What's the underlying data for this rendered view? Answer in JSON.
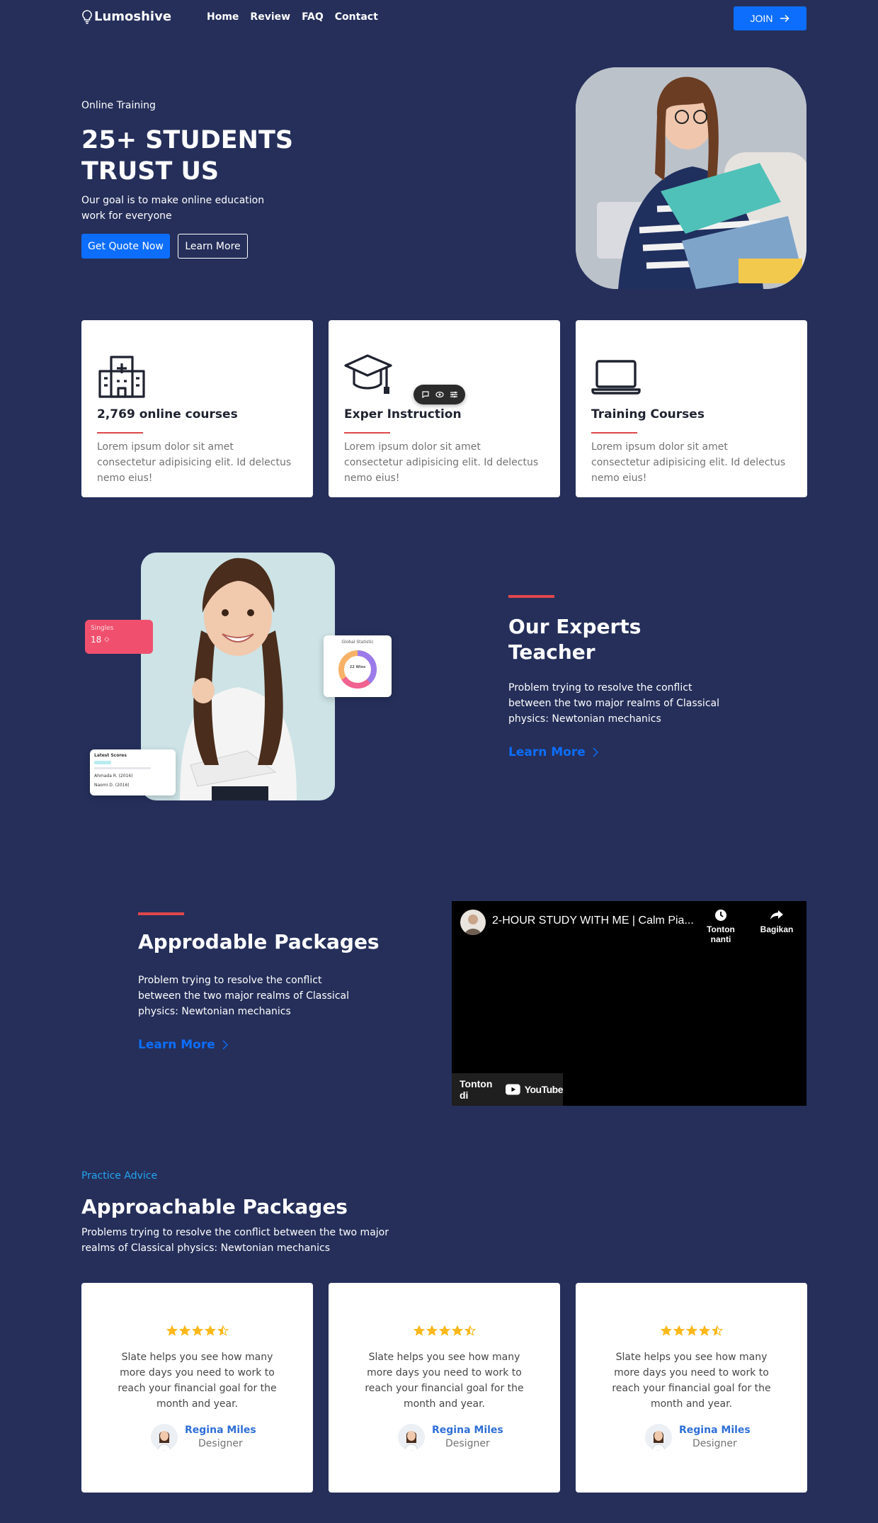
{
  "nav": {
    "logo": "Lumoshive",
    "links": [
      "Home",
      "Review",
      "FAQ",
      "Contact"
    ],
    "join_label": "JOIN"
  },
  "hero": {
    "eyebrow": "Online Training",
    "title": "25+ STUDENTS TRUST US",
    "description": "Our goal is to make online education work for everyone",
    "primary_button": "Get Quote Now",
    "secondary_button": "Learn More"
  },
  "features": [
    {
      "icon": "hospital-building-icon",
      "title": "2,769 online courses",
      "text": "Lorem ipsum dolor sit amet consectetur adipisicing elit. Id delectus nemo eius!"
    },
    {
      "icon": "graduation-cap-icon",
      "title": "Exper Instruction",
      "text": "Lorem ipsum dolor sit amet consectetur adipisicing elit. Id delectus nemo eius!"
    },
    {
      "icon": "laptop-icon",
      "title": "Training Courses",
      "text": "Lorem ipsum dolor sit amet consectetur adipisicing elit. Id delectus nemo eius!"
    }
  ],
  "experts": {
    "title": "Our Experts Teacher",
    "description": "Problem trying to resolve the conflict between the two major realms of Classical physics: Newtonian mechanics",
    "link": "Learn More",
    "badge_label": "Singles",
    "badge_value": "18",
    "stat_title": "Global Statistic",
    "stat_center": "22 Wins",
    "score_title": "Latest Scores",
    "score_rows": [
      "Ahmada R. (2016)",
      "Naomi D. (2016)"
    ]
  },
  "packages": {
    "title": "Approdable Packages",
    "description": "Problem trying to resolve the conflict between the two major realms of Classical physics: Newtonian mechanics",
    "link": "Learn More",
    "video": {
      "title": "2-HOUR STUDY WITH ME | Calm Pia...",
      "watch_later": "Tonton nanti",
      "share": "Bagikan",
      "watch_on": "Tonton di",
      "youtube": "YouTube"
    }
  },
  "testimonials": {
    "eyebrow": "Practice Advice",
    "title": "Approachable Packages",
    "description": "Problems trying to resolve the conflict between the two major realms of Classical physics: Newtonian mechanics",
    "rating": 4.5,
    "items": [
      {
        "quote": "Slate helps you see how many more days you need to work to reach your financial goal for the month and year.",
        "name": "Regina Miles",
        "role": "Designer"
      },
      {
        "quote": "Slate helps you see how many more days you need to work to reach your financial goal for the month and year.",
        "name": "Regina Miles",
        "role": "Designer"
      },
      {
        "quote": "Slate helps you see how many more days you need to work to reach your financial goal for the month and year.",
        "name": "Regina Miles",
        "role": "Designer"
      }
    ]
  },
  "colors": {
    "background": "#252f5a",
    "primary": "#0d6efd",
    "accent_red": "#e0474c",
    "star": "#fcb81c",
    "eyebrow_blue": "#23a6f0"
  }
}
